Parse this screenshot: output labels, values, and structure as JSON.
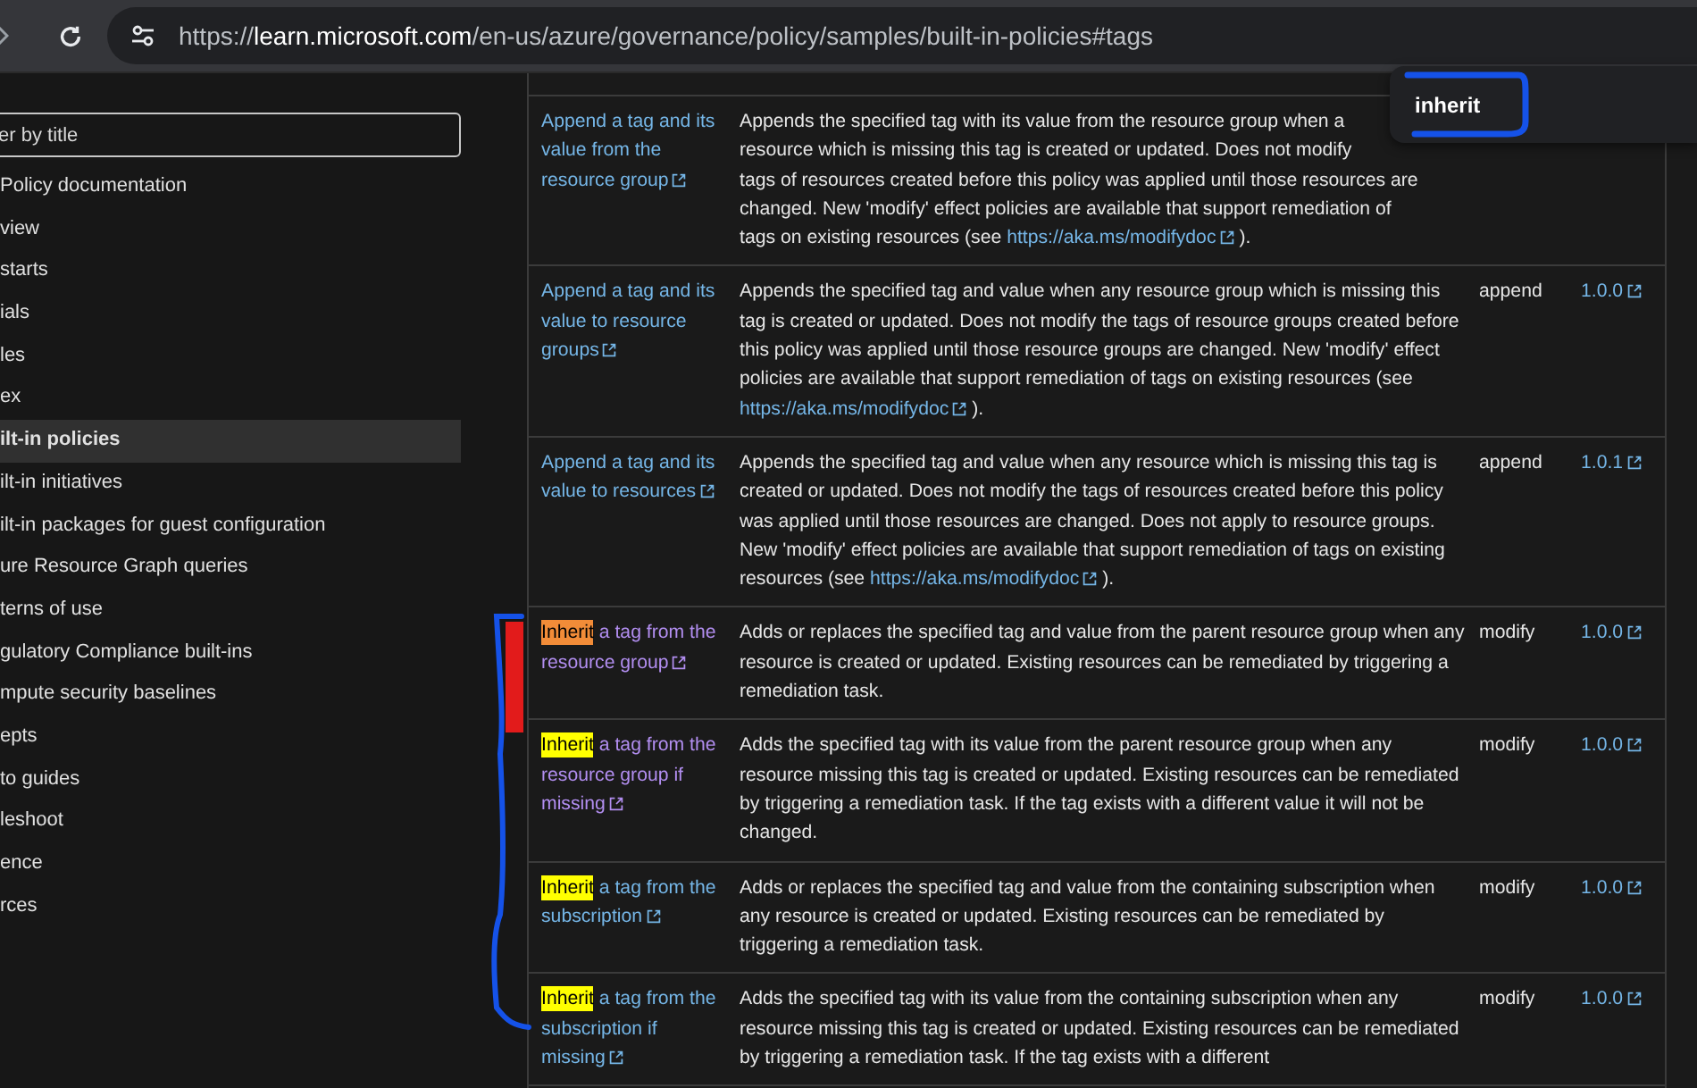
{
  "browser": {
    "url": "https://**learn.microsoft.com**/en-us/azure/governance/policy/samples/built-in-policies#tags"
  },
  "sidebar": {
    "filter": {
      "placeholder": "er by title"
    },
    "items": [
      {
        "label": "Policy documentation",
        "selected": false
      },
      {
        "label": "view",
        "selected": false
      },
      {
        "label": "starts",
        "selected": false
      },
      {
        "label": "ials",
        "selected": false
      },
      {
        "label": "les",
        "selected": false
      },
      {
        "label": "ex",
        "selected": false
      },
      {
        "label": "ilt-in policies",
        "selected": true
      },
      {
        "label": "ilt-in initiatives",
        "selected": false
      },
      {
        "label": "ilt-in packages for guest configuration",
        "selected": false
      },
      {
        "label": "ure Resource Graph queries",
        "selected": false
      },
      {
        "label": "terns of use",
        "selected": false
      },
      {
        "label": "gulatory Compliance built-ins",
        "selected": false
      },
      {
        "label": "mpute security baselines",
        "selected": false
      },
      {
        "label": "epts",
        "selected": false
      },
      {
        "label": "to guides",
        "selected": false
      },
      {
        "label": "leshoot",
        "selected": false
      },
      {
        "label": "ence",
        "selected": false
      },
      {
        "label": "rces",
        "selected": false
      }
    ]
  },
  "table": {
    "rows": [
      {
        "title": "Append a tag and its value from the resource group",
        "visited": false,
        "match": null,
        "description": "Appends the specified tag with its value from the resource group when a\nresource which is missing this tag is created or updated. Does not modify\ntags of resources created before this policy was applied until those resources are\nchanged. New 'modify' effect policies are available that support remediation of\ntags on existing resources (see ",
        "link": "https://aka.ms/modifydoc",
        "description_end": " ).",
        "effect": "",
        "version": ""
      },
      {
        "title": "Append a tag and its value to resource groups",
        "visited": false,
        "match": null,
        "description": "Appends the specified tag and value when any resource group which is missing this tag is created or updated. Does not modify the tags of resource groups created before this policy was applied until those resource groups are changed. New 'modify' effect policies are available that support remediation of tags on existing resources (see ",
        "link": "https://aka.ms/modifydoc",
        "description_end": " ).",
        "effect": "append",
        "version": "1.0.0"
      },
      {
        "title": "Append a tag and its value to resources",
        "visited": false,
        "match": null,
        "description": "Appends the specified tag and value when any resource which is missing this tag is created or updated. Does not modify the tags of resources created before this policy was applied until those resources are changed. Does not apply to resource groups. New 'modify' effect policies are available that support remediation of tags on existing resources (see ",
        "link": "https://aka.ms/modifydoc",
        "description_end": " ).",
        "effect": "append",
        "version": "1.0.1"
      },
      {
        "title": " a tag from the resource group",
        "visited": true,
        "match": {
          "text": "Inherit",
          "current": true
        },
        "description": "Adds or replaces the specified tag and value from the parent resource group when any resource is created or updated. Existing resources can be remediated by triggering a remediation task.",
        "effect": "modify",
        "version": "1.0.0"
      },
      {
        "title": " a tag from the resource group if missing",
        "visited": true,
        "match": {
          "text": "Inherit",
          "current": false
        },
        "description": "Adds the specified tag with its value from the parent resource group when any resource missing this tag is created or updated. Existing resources can be remediated by triggering a remediation task. If the tag exists with a different value it will not be changed.",
        "effect": "modify",
        "version": "1.0.0"
      },
      {
        "title": " a tag from the subscription",
        "visited": false,
        "match": {
          "text": "Inherit",
          "current": false
        },
        "description": "Adds or replaces the specified tag and value from the containing subscription when any resource is created or updated. Existing resources can be remediated by triggering a remediation task.",
        "effect": "modify",
        "version": "1.0.0"
      },
      {
        "title": " a tag from the subscription if missing",
        "visited": false,
        "match": {
          "text": "Inherit",
          "current": false
        },
        "description": "Adds the specified tag with its value from the containing subscription when any resource missing this tag is created or updated. Existing resources can be remediated by triggering a remediation task. If the tag exists with a different",
        "effect": "modify",
        "version": "1.0.0"
      }
    ]
  },
  "find_bar": {
    "value": "inherit"
  }
}
